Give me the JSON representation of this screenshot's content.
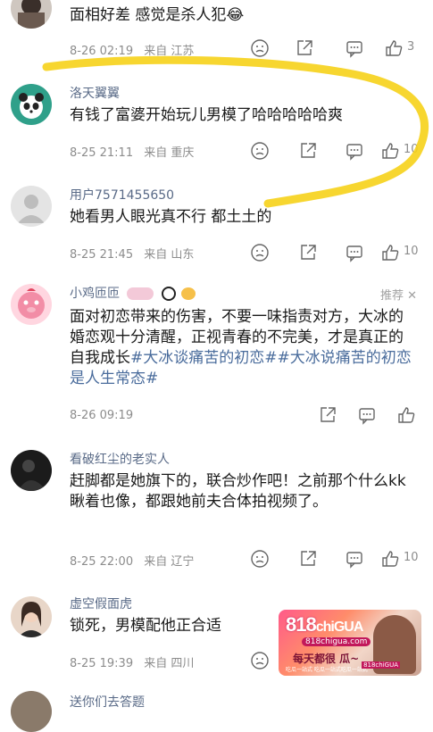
{
  "comments": [
    {
      "username": "",
      "text": "面相好差 感觉是杀人犯😂",
      "time": "8-26 02:19",
      "location": "来自 江苏",
      "likes": "3"
    },
    {
      "username": "洛天翼翼",
      "text": "有钱了富婆开始玩儿男模了哈哈哈哈哈爽",
      "time": "8-25 21:11",
      "location": "来自 重庆",
      "likes": "10"
    },
    {
      "username": "用户7571455650",
      "text": "她看男人眼光真不行 都土土的",
      "time": "8-25 21:45",
      "location": "来自 山东",
      "likes": "10"
    },
    {
      "username": "小鸡匝匝",
      "recommend": "推荐 ✕",
      "text_plain": "面对初恋带来的伤害，不要一味指责对方，大冰的婚恋观十分清醒，正视青春的不完美，才是真正的自我成长",
      "tag1": "#大冰谈痛苦的初恋#",
      "tag2": "#大冰说痛苦的初恋是人生常态#",
      "time": "8-26 09:19",
      "location": "",
      "likes": ""
    },
    {
      "username": "看破红尘的老实人",
      "text": "赶脚都是她旗下的，联合炒作吧！之前那个什么kk瞅着也像，都跟她前夫合体拍视频了。",
      "time": "8-25 22:00",
      "location": "来自 辽宁",
      "likes": "10"
    },
    {
      "username": "虚空假面虎",
      "text": "锁死，男模配他正合适",
      "time": "8-25 19:39",
      "location": "来自 四川",
      "likes": ""
    },
    {
      "username": "送你们去答题",
      "text": "",
      "time": "",
      "location": "",
      "likes": ""
    }
  ],
  "ad": {
    "brand_num": "818",
    "brand_word": "chiGUA",
    "site": "818chigua.com",
    "slogan": "每天都很 瓜~",
    "sub": "吃瓜一站式 吃瓜一站式吃瓜一站式",
    "logo2": "818chiGUA"
  },
  "colors": {
    "username": "#596a87",
    "meta": "#8c8c8c",
    "hashtag": "#4a6c9c",
    "annotation_stroke": "#f6d21a"
  },
  "icons": [
    "dislike-icon",
    "share-icon",
    "reply-icon",
    "like-icon",
    "close-icon"
  ]
}
